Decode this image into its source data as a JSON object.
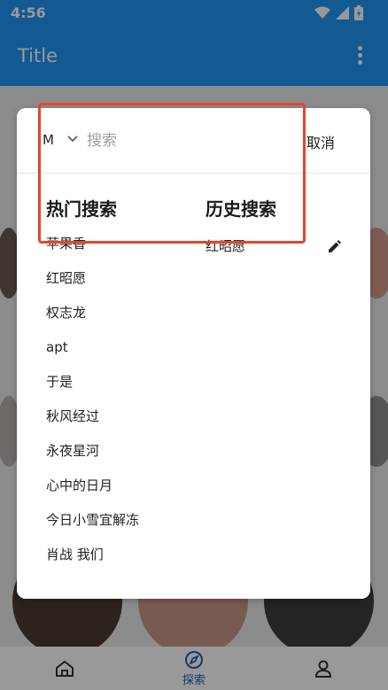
{
  "status_bar": {
    "time": "4:56"
  },
  "app_bar": {
    "title": "Title"
  },
  "dialog": {
    "scope_label": "M",
    "search_placeholder": "搜索",
    "cancel_label": "取消",
    "hot_title": "热门搜索",
    "history_title": "历史搜索",
    "hot_items": [
      "苹果香",
      "红昭愿",
      "权志龙",
      "apt",
      "于是",
      "秋风经过",
      "永夜星河",
      "心中的日月",
      "今日小雪宜解冻",
      "肖战 我们"
    ],
    "history_items": [
      "红昭愿"
    ]
  },
  "bottom_nav": {
    "explore_label": "探索"
  },
  "colors": {
    "primary": "#2196F3",
    "nav_active": "#1e5fb8",
    "highlight": "#e4462e"
  }
}
